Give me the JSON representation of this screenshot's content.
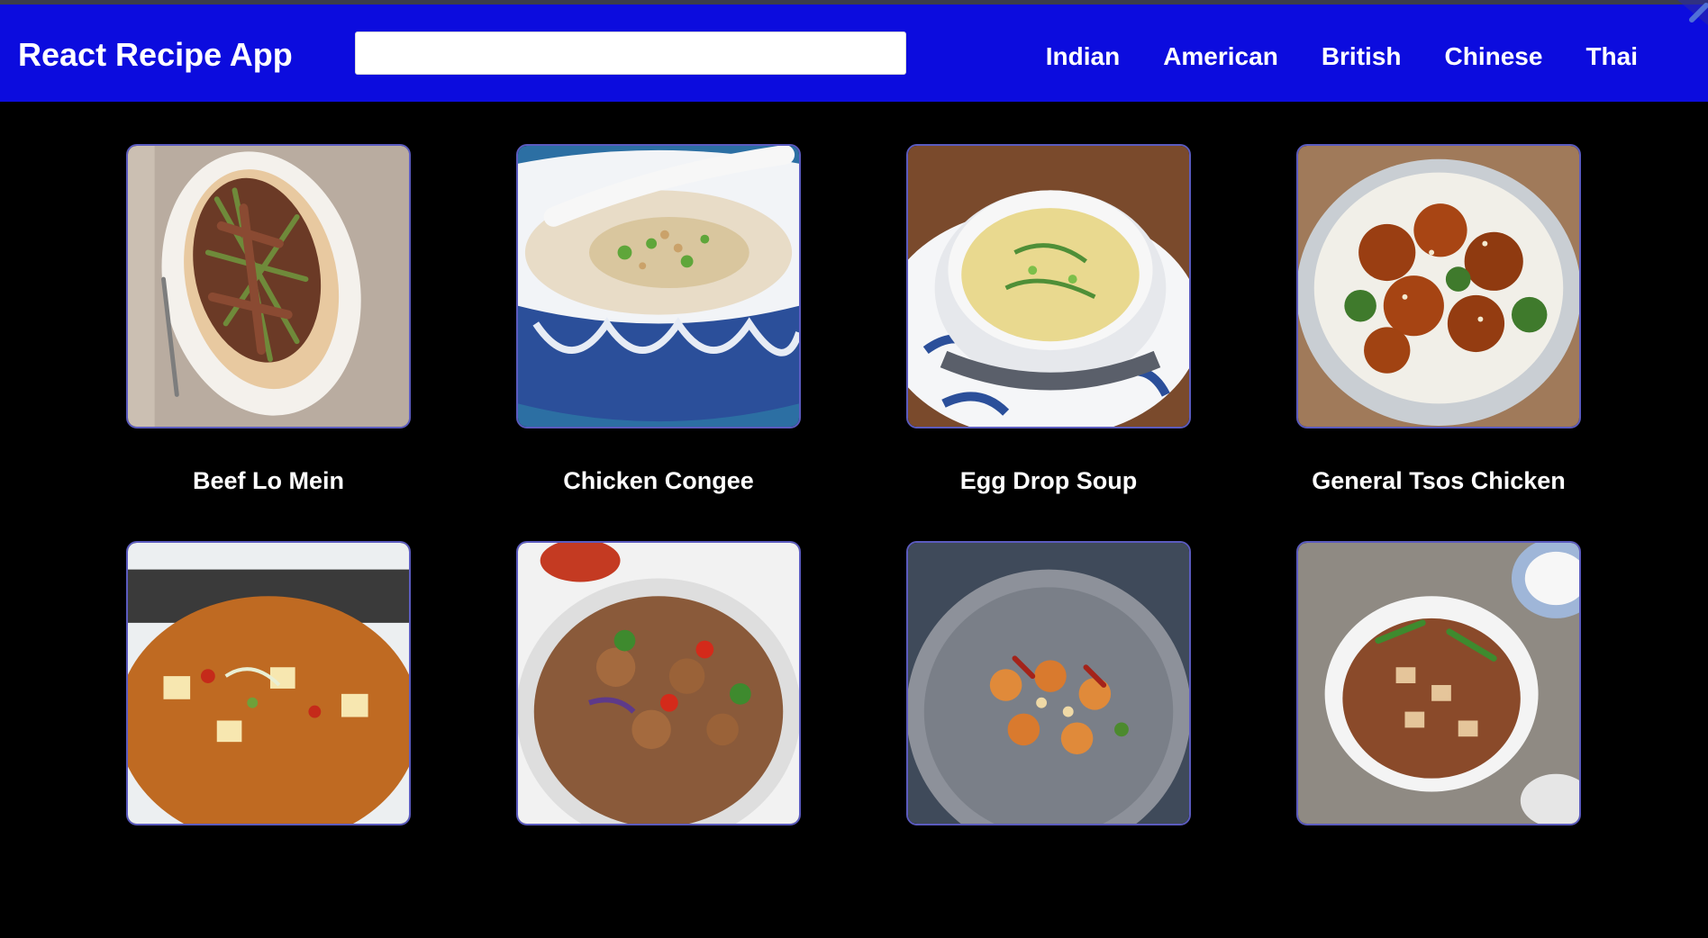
{
  "app": {
    "title": "React Recipe App"
  },
  "search": {
    "value": "",
    "placeholder": ""
  },
  "nav": {
    "items": [
      {
        "label": "Indian"
      },
      {
        "label": "American"
      },
      {
        "label": "British"
      },
      {
        "label": "Chinese"
      },
      {
        "label": "Thai"
      }
    ]
  },
  "colors": {
    "navbar": "#0c0cde",
    "background": "#000000",
    "card_border": "#5b5bbf"
  },
  "recipes": [
    {
      "name": "Beef Lo Mein",
      "image": "beef-lo-mein-photo"
    },
    {
      "name": "Chicken Congee",
      "image": "chicken-congee-photo"
    },
    {
      "name": "Egg Drop Soup",
      "image": "egg-drop-soup-photo"
    },
    {
      "name": "General Tsos Chicken",
      "image": "general-tsos-chicken-photo"
    },
    {
      "name": "",
      "image": "hot-and-sour-soup-photo"
    },
    {
      "name": "",
      "image": "chicken-stir-fry-photo"
    },
    {
      "name": "",
      "image": "kung-pao-shrimp-photo"
    },
    {
      "name": "",
      "image": "mapo-tofu-photo"
    }
  ]
}
